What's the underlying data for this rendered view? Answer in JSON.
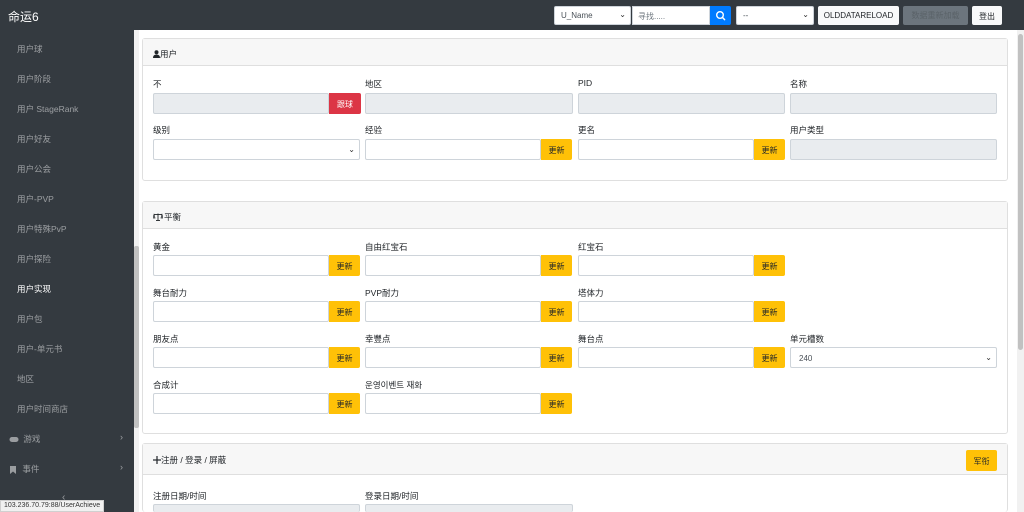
{
  "app": {
    "brand": "命运6"
  },
  "topbar": {
    "user_select": "U_Name",
    "search_placeholder": "寻找.....",
    "server_select": "--",
    "reload_label": "OLDDATARELOAD",
    "disabled_label": "数据重新加载",
    "logout_label": "登出"
  },
  "sidebar": {
    "items": [
      {
        "label": "用户球"
      },
      {
        "label": "用户阶段"
      },
      {
        "label": "用户 StageRank"
      },
      {
        "label": "用户好友"
      },
      {
        "label": "用户公会"
      },
      {
        "label": "用户-PVP"
      },
      {
        "label": "用户特殊PvP"
      },
      {
        "label": "用户探险"
      },
      {
        "label": "用户实现"
      },
      {
        "label": "用户包"
      },
      {
        "label": "用户-单元书"
      },
      {
        "label": "地区"
      },
      {
        "label": "用户时间商店"
      }
    ],
    "groups": [
      {
        "label": "游戏"
      },
      {
        "label": "事件"
      }
    ],
    "status_url": "103.236.70.79:88/UserAchieve"
  },
  "user_card": {
    "title": "用户",
    "fields": {
      "not_label": "不",
      "follow_label": "跟球",
      "region_label": "地区",
      "pid_label": "PID",
      "name_label": "名称",
      "level_label": "级别",
      "exp_label": "经验",
      "exp_btn": "更新",
      "rename_label": "更名",
      "rename_btn": "更新",
      "usertype_label": "用户类型"
    }
  },
  "balance_card": {
    "title": "平衡",
    "gold_label": "黄金",
    "gold_btn": "更新",
    "free_ruby_label": "自由红宝石",
    "free_ruby_btn": "更新",
    "ruby_label": "红宝石",
    "ruby_btn": "更新",
    "stage_stamina_label": "舞台耐力",
    "stage_stamina_btn": "更新",
    "pvp_stamina_label": "PVP耐力",
    "pvp_stamina_btn": "更新",
    "tower_stamina_label": "塔体力",
    "tower_stamina_btn": "更新",
    "friend_points_label": "朋友点",
    "friend_points_btn": "更新",
    "luck_points_label": "幸豐点",
    "luck_points_btn": "更新",
    "stage_points_label": "舞台点",
    "stage_points_btn": "更新",
    "unit_slots_label": "单元槽数",
    "unit_slots_value": "240",
    "synthesis_label": "合成计",
    "synthesis_btn": "更新",
    "event_label": "운영이벤트 재화",
    "event_btn": "更新"
  },
  "register_card": {
    "title": "注册 / 登录 / 屏蔽",
    "ban_btn": "军衔",
    "register_date_label": "注册日期/时间",
    "login_date_label": "登录日期/时间"
  },
  "colors": {
    "topbar": "#343a40",
    "warning": "#ffc107",
    "danger": "#dc3545",
    "primary": "#007bff"
  }
}
